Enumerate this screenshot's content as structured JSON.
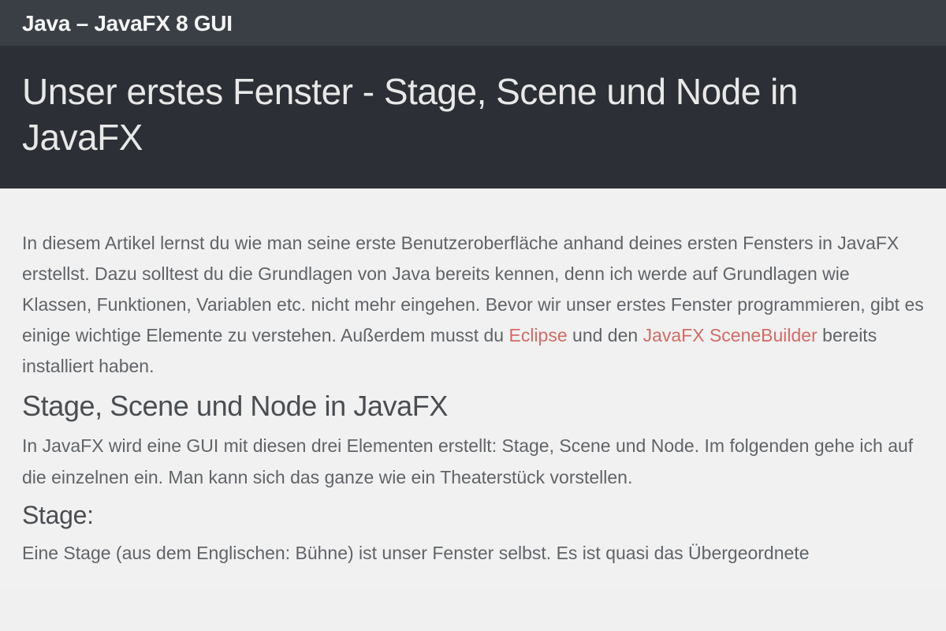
{
  "topbar": {
    "title": "Java – JavaFX 8 GUI"
  },
  "hero": {
    "title": "Unser erstes Fenster - Stage, Scene und Node in JavaFX"
  },
  "content": {
    "intro_part1": "In diesem Artikel lernst du wie man seine erste Benutzeroberfläche anhand deines ersten Fensters in JavaFX erstellst. Dazu solltest du die Grundlagen von Java bereits kennen, denn ich werde auf Grundlagen wie Klassen, Funktionen, Variablen etc. nicht mehr eingehen. Bevor wir unser erstes Fenster programmieren, gibt es einige wichtige Elemente zu verstehen. Außerdem musst du ",
    "link_eclipse": "Eclipse",
    "intro_mid": " und den ",
    "link_scenebuilder": "JavaFX SceneBuilder",
    "intro_end": " bereits installiert haben.",
    "heading_ssn": "Stage, Scene und Node in JavaFX",
    "ssn_para": "In JavaFX wird eine GUI mit diesen drei Elementen erstellt: Stage, Scene und Node. Im folgenden gehe ich auf die einzelnen ein. Man kann sich das ganze wie ein Theaterstück vorstellen.",
    "heading_stage": "Stage:",
    "stage_para": "Eine Stage (aus dem Englischen: Bühne) ist unser Fenster selbst. Es ist quasi das Übergeordnete"
  }
}
